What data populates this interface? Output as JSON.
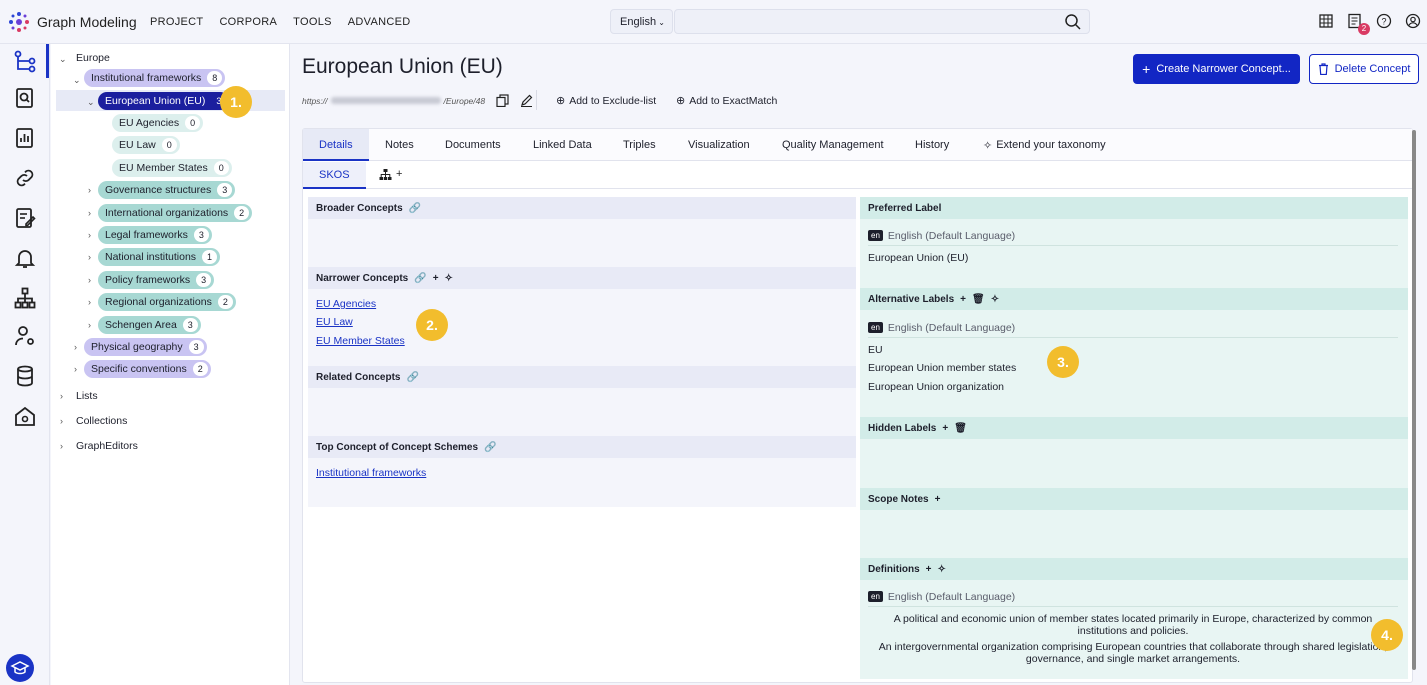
{
  "app": {
    "name": "Graph Modeling"
  },
  "nav": [
    "PROJECT",
    "CORPORA",
    "TOOLS",
    "ADVANCED"
  ],
  "language_selector": "English",
  "notifications_count": "2",
  "tree": {
    "root": "Europe",
    "institutional": {
      "label": "Institutional frameworks",
      "count": "8"
    },
    "eu": {
      "label": "European Union (EU)",
      "count": "3"
    },
    "eu_children": [
      {
        "label": "EU Agencies",
        "count": "0"
      },
      {
        "label": "EU Law",
        "count": "0"
      },
      {
        "label": "EU Member States",
        "count": "0"
      }
    ],
    "siblings": [
      {
        "label": "Governance structures",
        "count": "3"
      },
      {
        "label": "International organizations",
        "count": "2"
      },
      {
        "label": "Legal frameworks",
        "count": "3"
      },
      {
        "label": "National institutions",
        "count": "1"
      },
      {
        "label": "Policy frameworks",
        "count": "3"
      },
      {
        "label": "Regional organizations",
        "count": "2"
      },
      {
        "label": "Schengen Area",
        "count": "3"
      }
    ],
    "top_level": [
      {
        "label": "Physical geography",
        "count": "3"
      },
      {
        "label": "Specific conventions",
        "count": "2"
      }
    ],
    "other_roots": [
      "Lists",
      "Collections",
      "GraphEditors"
    ]
  },
  "callouts": [
    "1.",
    "2.",
    "3.",
    "4."
  ],
  "concept": {
    "title": "European Union (EU)",
    "uri_prefix": "https://",
    "uri_suffix": "/Europe/48",
    "add_exclude": "Add to Exclude-list",
    "add_exact": "Add to ExactMatch",
    "create_btn": "Create Narrower Concept...",
    "delete_btn": "Delete Concept"
  },
  "tabs": [
    "Details",
    "Notes",
    "Documents",
    "Linked Data",
    "Triples",
    "Visualization",
    "Quality Management",
    "History",
    "Extend your taxonomy"
  ],
  "subtabs": {
    "skos": "SKOS",
    "plus": "+"
  },
  "left": {
    "broader": "Broader Concepts",
    "narrower": "Narrower Concepts",
    "narrower_items": [
      "EU Agencies",
      "EU Law",
      "EU Member States"
    ],
    "related": "Related Concepts",
    "top_concept": "Top Concept of Concept Schemes",
    "top_concept_items": [
      "Institutional frameworks"
    ]
  },
  "right": {
    "lang_tag": "en",
    "lang_name": "English",
    "lang_default": "(Default Language)",
    "preferred": "Preferred Label",
    "preferred_value": "European Union (EU)",
    "alternative": "Alternative Labels",
    "alt_values": [
      "EU",
      "European Union member states",
      "European Union organization"
    ],
    "hidden": "Hidden Labels",
    "scope": "Scope Notes",
    "definitions": "Definitions",
    "def1": "A political and economic union of member states located primarily in Europe, characterized by common institutions and policies.",
    "def2": "An intergovernmental organization comprising European countries that collaborate through shared legislation, governance, and single market arrangements."
  },
  "colors": {
    "accent": "#1226c4",
    "callout": "#f2bd2d",
    "teal_pill": "#a7d8d3",
    "purple_pill": "#c9c4f2"
  }
}
